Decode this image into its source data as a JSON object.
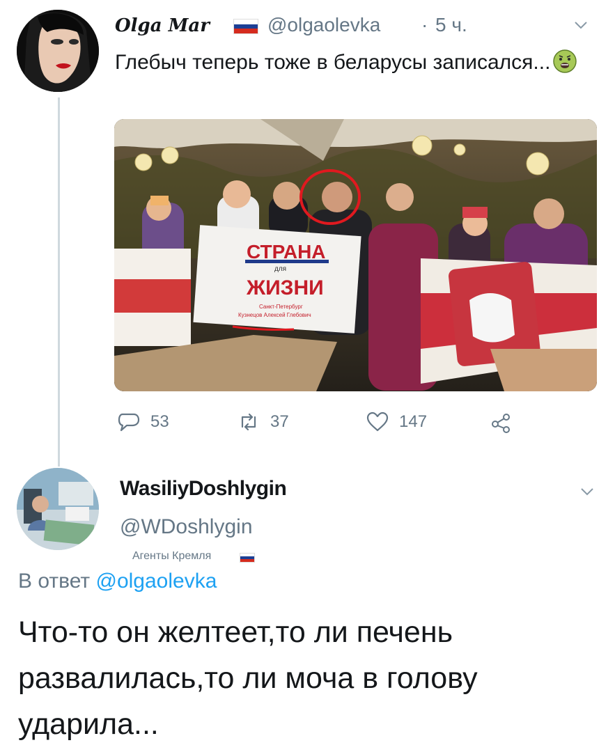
{
  "tweet1": {
    "display_name": "Olga Mar",
    "handle": "@olgaolevka",
    "separator": "·",
    "time": "5 ч.",
    "text": "Глебыч теперь тоже в беларусы записался...",
    "flag_icon": "russia-flag-icon",
    "emoji_icon": "nauseated-face-icon",
    "photo": {
      "banner_text_top": "СТРАНА",
      "banner_text_mid": "для",
      "banner_text_bottom": "ЖИЗНИ",
      "banner_small_line1": "Санкт-Петербург",
      "banner_small_line2": "Кузнецов Алексей Глебович"
    },
    "actions": {
      "replies": "53",
      "retweets": "37",
      "likes": "147"
    }
  },
  "tweet2": {
    "display_name": "WasiliyDoshlygin",
    "handle": "@WDoshlygin",
    "label": "Агенты Кремля",
    "reply_prefix": "В ответ",
    "reply_mention": "@olgaolevka",
    "text": "Что-то он желтеет,то ли печень развалилась,то ли моча в голову ударила..."
  },
  "colors": {
    "text": "#14171a",
    "secondary": "#657786",
    "link": "#1da1f2",
    "thread_line": "#cfd9de",
    "annotation_red": "#e0191f"
  }
}
